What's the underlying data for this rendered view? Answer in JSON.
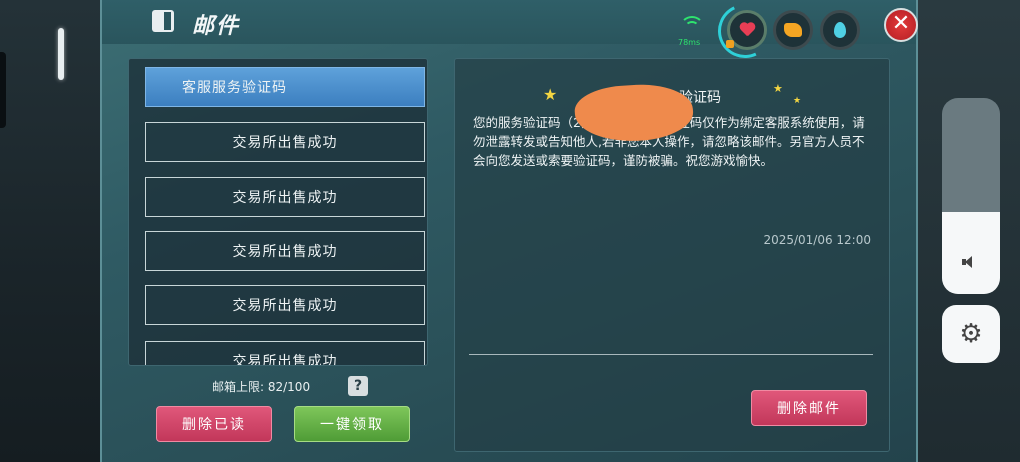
{
  "header": {
    "title": "邮件"
  },
  "status": {
    "signal_text": "78ms"
  },
  "mail_list": {
    "items": [
      {
        "label": "客服服务验证码",
        "selected": true
      },
      {
        "label": "交易所出售成功",
        "selected": false
      },
      {
        "label": "交易所出售成功",
        "selected": false
      },
      {
        "label": "交易所出售成功",
        "selected": false
      },
      {
        "label": "交易所出售成功",
        "selected": false
      },
      {
        "label": "交易所出售成功",
        "selected": false
      }
    ]
  },
  "footer": {
    "quota_label": "邮箱上限: 82/100",
    "help": "?",
    "delete_read": "删除已读",
    "collect_all": "一键领取"
  },
  "detail": {
    "title": "客服服务验证码",
    "body": "您的服务验证码（2分钟内有效),该验证码仅作为绑定客服系统使用，请勿泄露转发或告知他人,若非您本人操作，请忽略该邮件。另官方人员不会向您发送或索要验证码，谨防被骗。祝您游戏愉快。",
    "time": "2025/01/06 12:00",
    "delete_button": "删除邮件"
  },
  "close_glyph": "✕",
  "colors": {
    "accent_blue": "#4a8fd0",
    "delete_red": "#d04468",
    "collect_green": "#62b044"
  }
}
